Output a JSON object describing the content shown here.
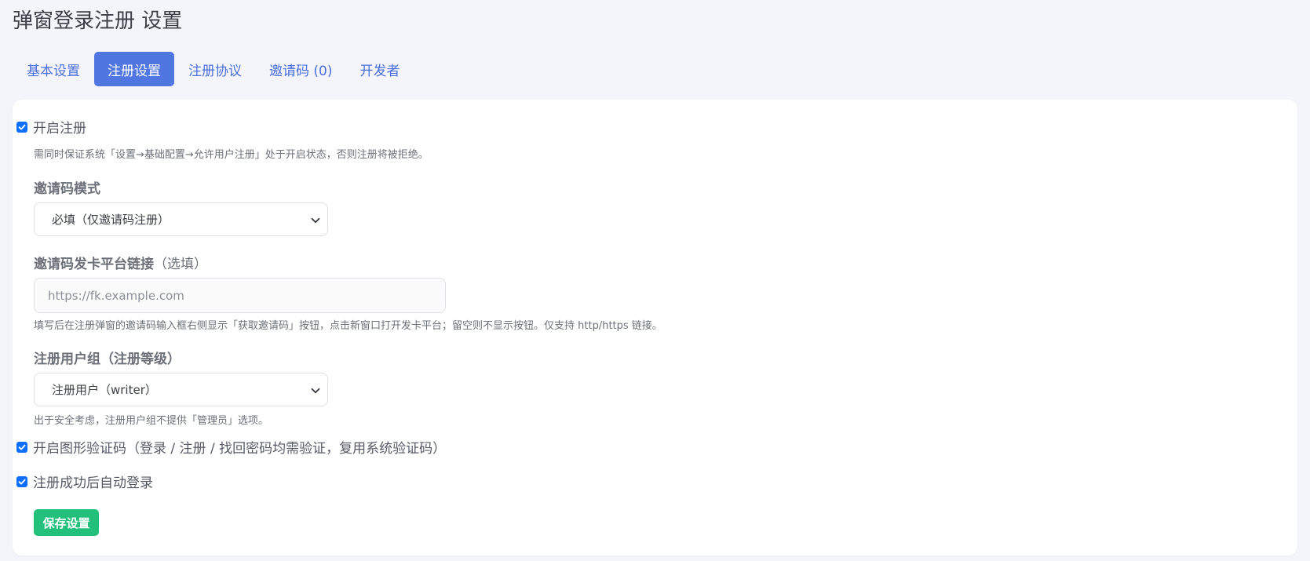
{
  "page": {
    "title": "弹窗登录注册 设置"
  },
  "tabs": [
    {
      "label": "基本设置",
      "active": false
    },
    {
      "label": "注册设置",
      "active": true
    },
    {
      "label": "注册协议",
      "active": false
    },
    {
      "label": "邀请码 (0)",
      "active": false
    },
    {
      "label": "开发者",
      "active": false
    }
  ],
  "register": {
    "enable_label": "开启注册",
    "enable_checked": true,
    "enable_help": "需同时保证系统「设置→基础配置→允许用户注册」处于开启状态，否则注册将被拒绝。",
    "invite_mode": {
      "label": "邀请码模式",
      "selected": "必填（仅邀请码注册）"
    },
    "invite_link": {
      "label": "邀请码发卡平台链接",
      "optional": "（选填）",
      "placeholder": "https://fk.example.com",
      "help": "填写后在注册弹窗的邀请码输入框右侧显示「获取邀请码」按钮，点击新窗口打开发卡平台；留空则不显示按钮。仅支持 http/https 链接。"
    },
    "user_group": {
      "label": "注册用户组（注册等级）",
      "selected": "注册用户（writer）",
      "help": "出于安全考虑，注册用户组不提供「管理员」选项。"
    },
    "captcha_label": "开启图形验证码（登录 / 注册 / 找回密码均需验证，复用系统验证码）",
    "captcha_checked": true,
    "autologin_label": "注册成功后自动登录",
    "autologin_checked": true,
    "save_label": "保存设置"
  },
  "colors": {
    "accent": "#4f76e1",
    "tab_text": "#4a6fdc",
    "checkbox": "#0d6efd",
    "save_button": "#22c07a",
    "background": "#f4f5fb"
  }
}
